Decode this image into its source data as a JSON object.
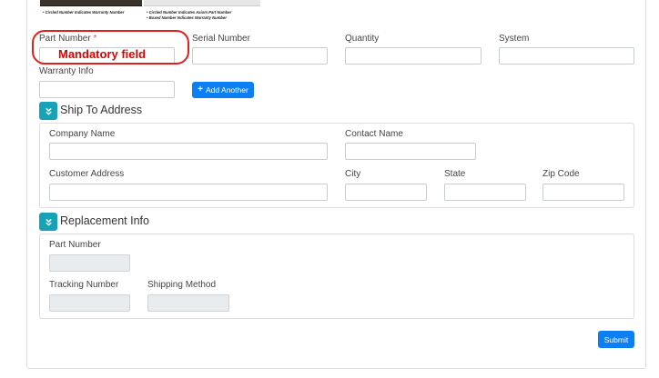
{
  "thumbnails": {
    "left_caption": "• Circled Number Indicates Warranty Number",
    "right_caption_1": "• Circled Number Indicates Axiom Part Number",
    "right_caption_2": "• Boxed Number Indicates Warranty Number"
  },
  "part_info": {
    "part_number_label": "Part Number",
    "required_marker": "*",
    "serial_number_label": "Serial Number",
    "quantity_label": "Quantity",
    "system_label": "System",
    "warranty_info_label": "Warranty Info",
    "add_another_label": "Add Another",
    "mandatory_annotation": "Mandatory field"
  },
  "ship_to": {
    "title": "Ship To Address",
    "company_name_label": "Company Name",
    "contact_name_label": "Contact Name",
    "customer_address_label": "Customer Address",
    "city_label": "City",
    "state_label": "State",
    "zip_code_label": "Zip Code"
  },
  "replacement": {
    "title": "Replacement Info",
    "part_number_label": "Part Number",
    "tracking_number_label": "Tracking Number",
    "shipping_method_label": "Shipping Method"
  },
  "actions": {
    "submit_label": "Submit"
  },
  "colors": {
    "primary": "#0d7ff5",
    "section_icon": "#17a2b8",
    "annotation": "#e00000",
    "required": "#d9534f"
  },
  "icons": {
    "add": "plus-icon",
    "section_toggle": "chevron-double-down-icon"
  }
}
